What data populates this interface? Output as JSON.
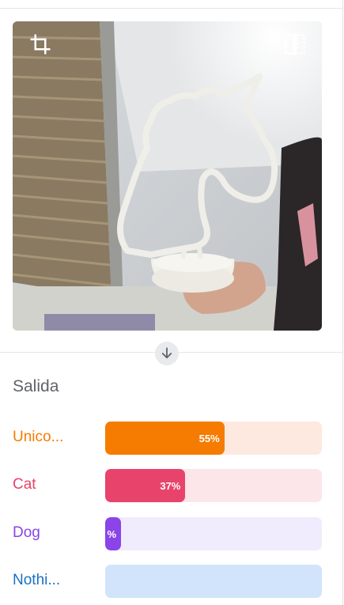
{
  "output": {
    "title": "Salida",
    "classes": [
      {
        "label": "Unico...",
        "percent_text": "55%",
        "level": 0.55,
        "color": "#f57c00",
        "track": "#fde9df"
      },
      {
        "label": "Cat",
        "percent_text": "37%",
        "level": 0.37,
        "color": "#e8436b",
        "track": "#fde6ea"
      },
      {
        "label": "Dog",
        "percent_text": "%",
        "level": 0.07,
        "color": "#8a44e8",
        "track": "#f0ecfd"
      },
      {
        "label": "Nothi...",
        "percent_text": "",
        "level": 0,
        "color": "#1a6fc4",
        "track": "#d1e4fb"
      }
    ]
  },
  "icons": {
    "crop": "crop-icon",
    "flip": "flip-camera-icon",
    "arrow": "arrow-down-icon"
  }
}
